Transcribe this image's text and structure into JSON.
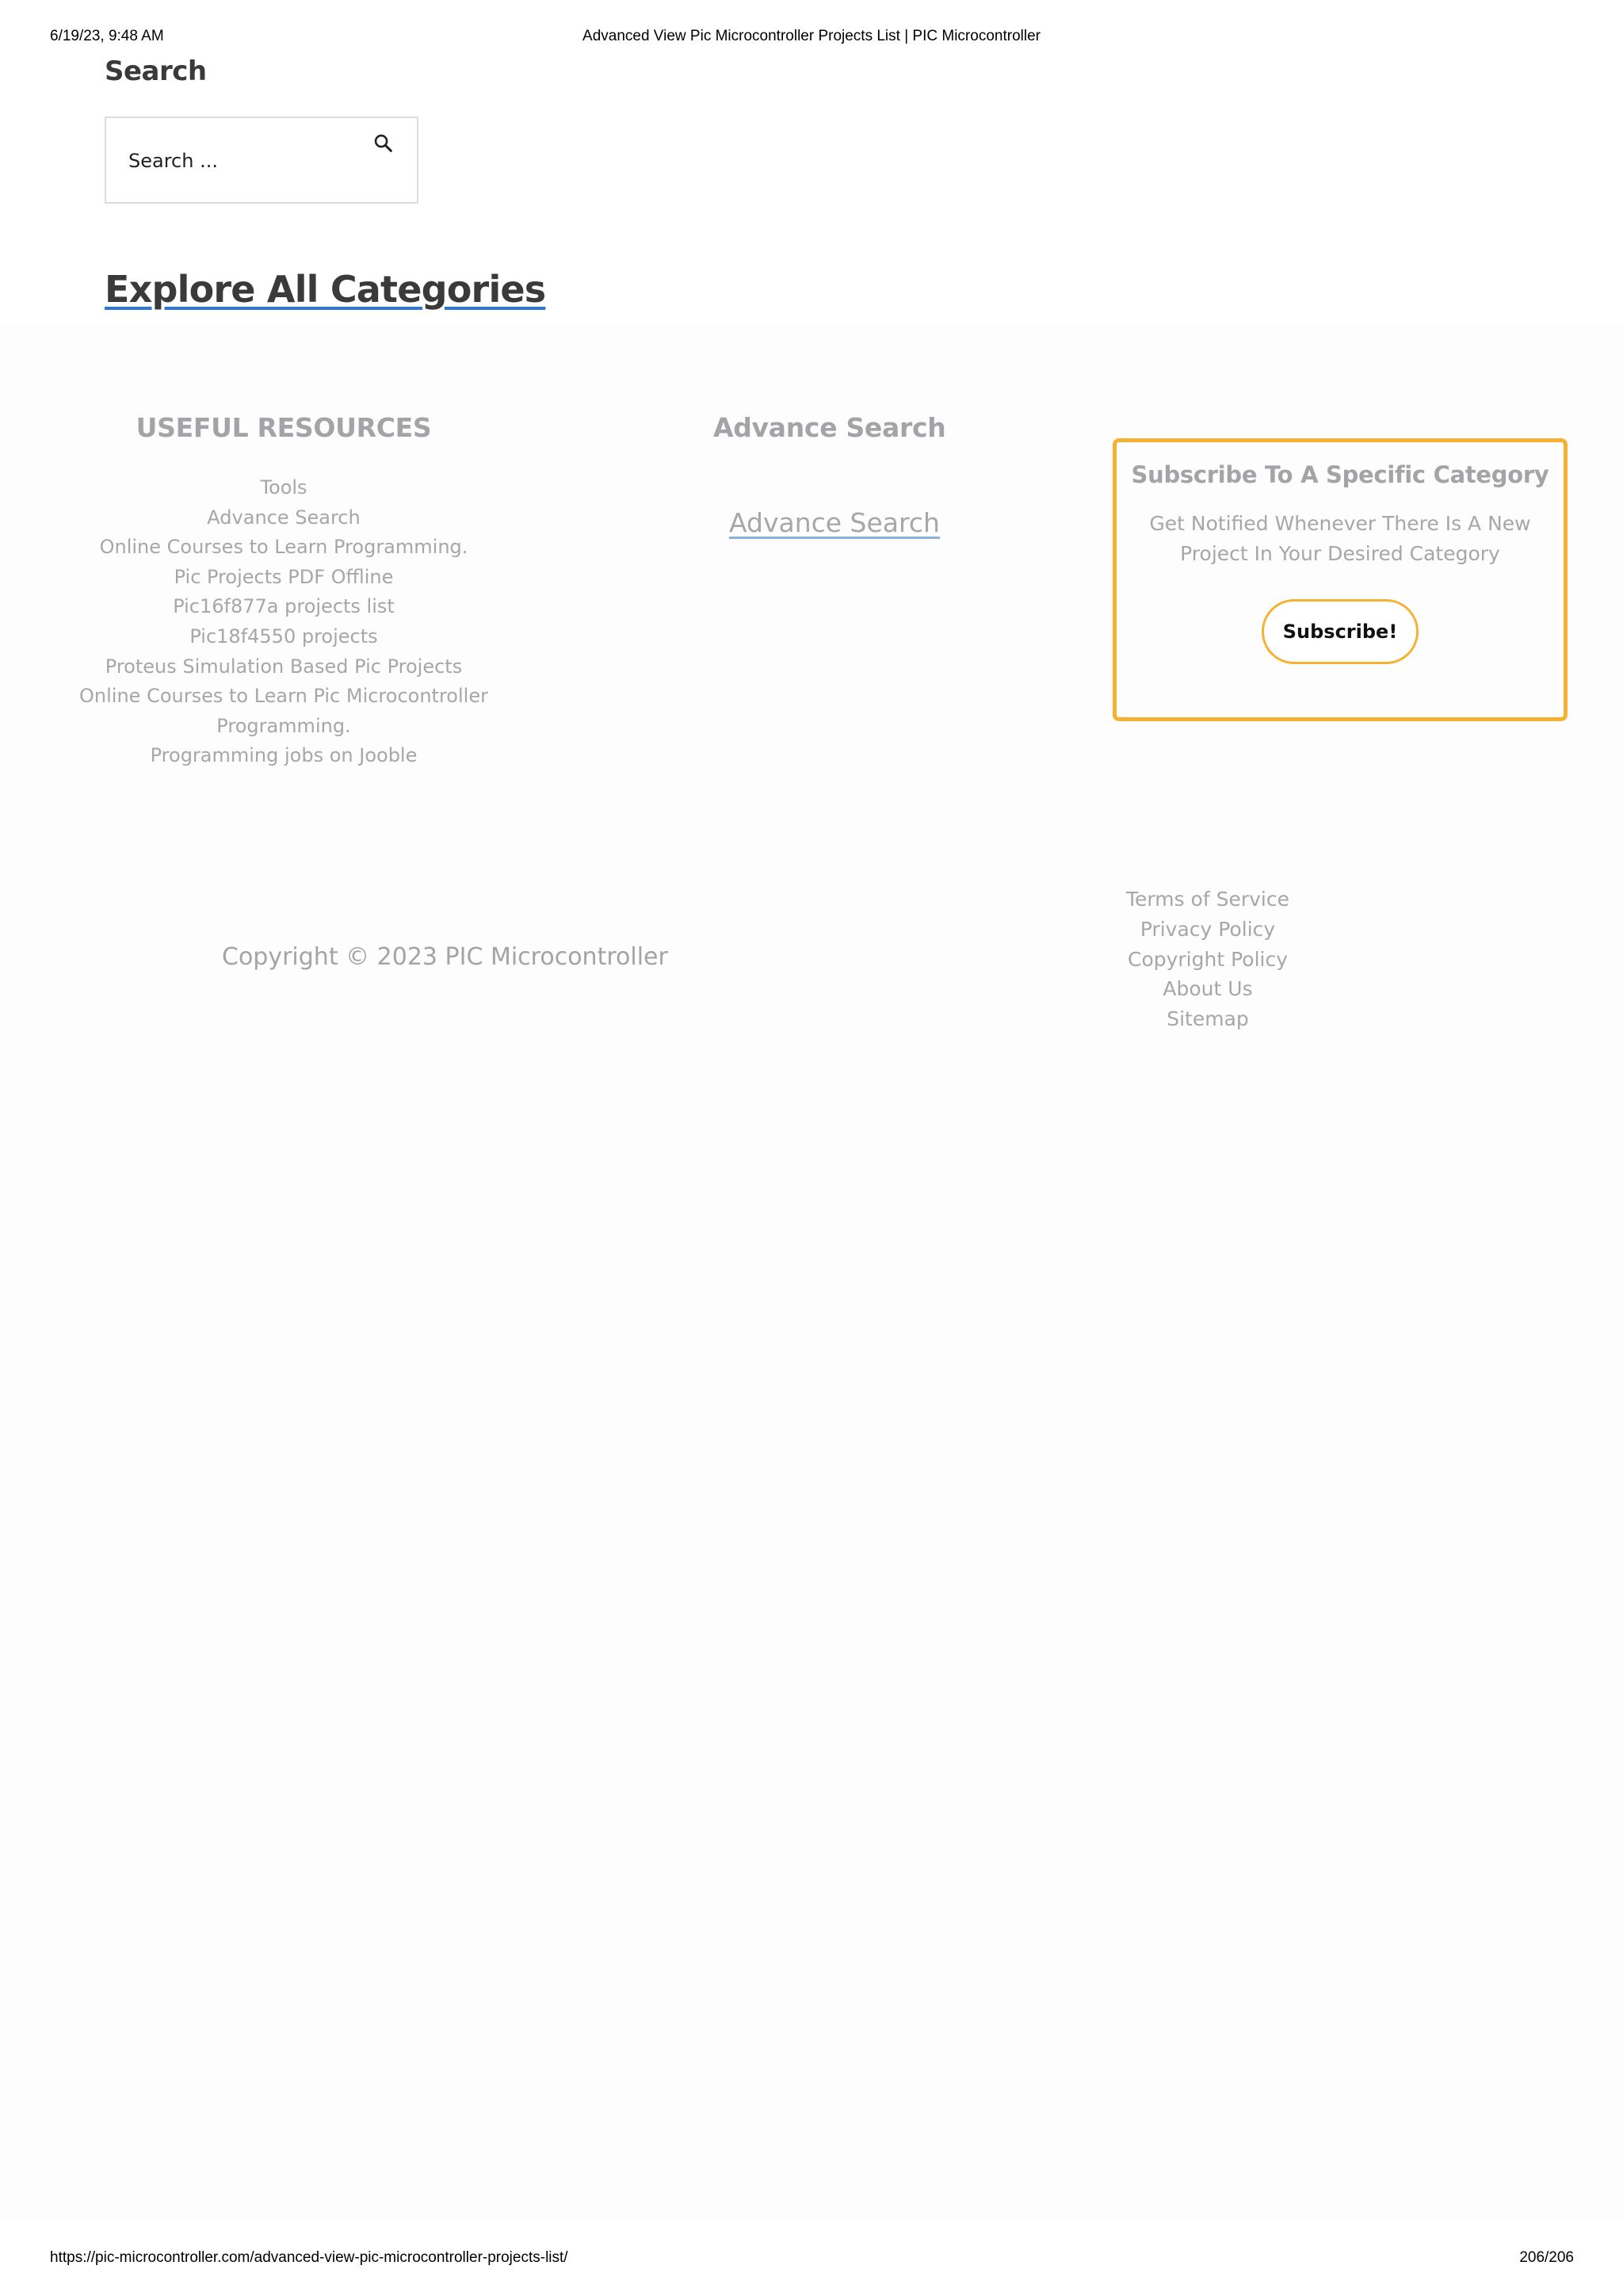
{
  "print_header": {
    "datetime": "6/19/23, 9:48 AM",
    "title": "Advanced View Pic Microcontroller Projects List | PIC Microcontroller"
  },
  "print_footer": {
    "url": "https://pic-microcontroller.com/advanced-view-pic-microcontroller-projects-list/",
    "page": "206/206"
  },
  "search_widget": {
    "heading": "Search",
    "placeholder": "Search ...",
    "icon": "search-icon"
  },
  "explore": {
    "label": "Explore All Categories"
  },
  "useful_resources": {
    "heading": "USEFUL RESOURCES",
    "items": [
      "Tools",
      "Advance Search",
      "Online Courses to Learn Programming.",
      "Pic Projects PDF Offline",
      "Pic16f877a projects list",
      "Pic18f4550 projects",
      "Proteus Simulation Based Pic Projects",
      "Online Courses to Learn Pic Microcontroller",
      "Programming.",
      "Programming jobs on Jooble"
    ]
  },
  "advance_search": {
    "heading": "Advance Search",
    "link": "Advance Search"
  },
  "subscribe": {
    "title": "Subscribe To A Specific Category",
    "description": "Get Notified Whenever There Is A New Project In Your Desired Category",
    "button": "Subscribe!",
    "accent_color": "#f5b232"
  },
  "footer": {
    "copyright": "Copyright © 2023 PIC Microcontroller",
    "links": [
      "Terms of Service",
      "Privacy Policy",
      "Copyright Policy",
      "About Us",
      "Sitemap"
    ]
  }
}
